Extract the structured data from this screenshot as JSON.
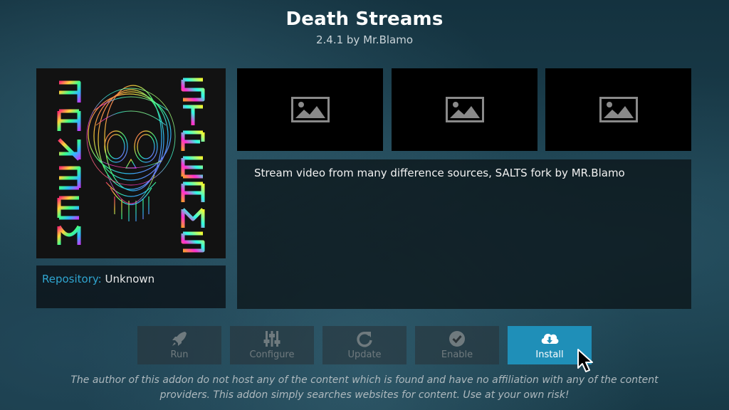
{
  "addon": {
    "title": "Death Streams",
    "version_author": "2.4.1 by Mr.Blamo",
    "poster_text_left": "DEATH",
    "poster_text_right": "STREAMS"
  },
  "repository": {
    "label": "Repository:",
    "value": "Unknown"
  },
  "screenshots": [
    {
      "icon": "image-placeholder-icon"
    },
    {
      "icon": "image-placeholder-icon"
    },
    {
      "icon": "image-placeholder-icon"
    }
  ],
  "description": "Stream video from many difference sources, SALTS fork by MR.Blamo",
  "actions": [
    {
      "label": "Run",
      "icon": "rocket-icon",
      "enabled": false
    },
    {
      "label": "Configure",
      "icon": "sliders-icon",
      "enabled": false
    },
    {
      "label": "Update",
      "icon": "refresh-icon",
      "enabled": false
    },
    {
      "label": "Enable",
      "icon": "check-circle-icon",
      "enabled": false
    },
    {
      "label": "Install",
      "icon": "cloud-download-icon",
      "enabled": true,
      "focused": true
    }
  ],
  "disclaimer": {
    "line1": "The author of this addon do not host any of the content which is found and have no affiliation with any of the content",
    "line2": "providers. This addon simply searches websites for content. Use at your own risk!"
  },
  "colors": {
    "accent": "#1f8fb8",
    "repo_label": "#2fa5d0"
  }
}
